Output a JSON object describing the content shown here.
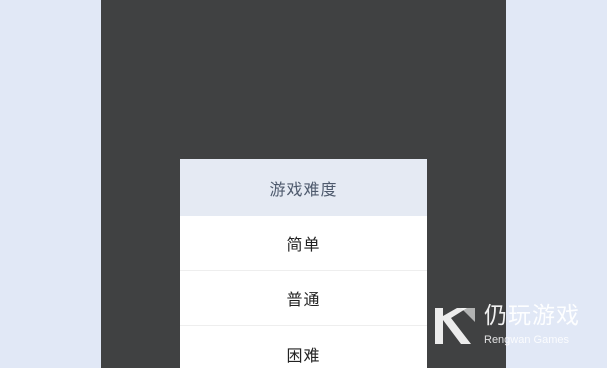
{
  "action_sheet": {
    "title": "游戏难度",
    "options": [
      {
        "label": "简单"
      },
      {
        "label": "普通"
      },
      {
        "label": "困难"
      }
    ]
  },
  "watermark": {
    "brand_cn": "仍玩游戏",
    "brand_en": "Rengwan Games",
    "logo_icon": "rengwan-logo-icon"
  },
  "colors": {
    "page_background": "#e1e8f6",
    "screen_background": "#404142",
    "sheet_header_background": "#e5eaf3",
    "sheet_header_text": "#4e5a6d",
    "option_text": "#222222"
  }
}
